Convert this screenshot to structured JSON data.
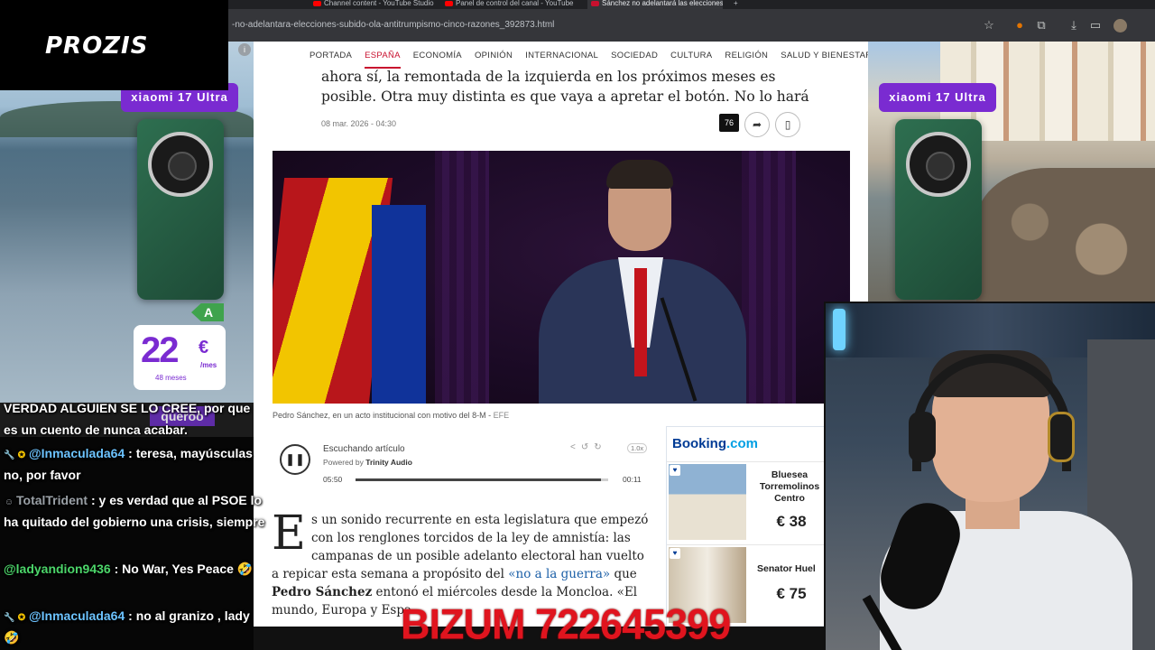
{
  "browser": {
    "tabs": [
      {
        "label": "Channel content - YouTube Studio",
        "active": false
      },
      {
        "label": "Panel de control del canal - YouTube",
        "active": false
      },
      {
        "label": "Sánchez no adelantará las elecciones",
        "active": true
      }
    ],
    "url": "-no-adelantara-elecciones-subido-ola-antitrumpismo-cinco-razones_392873.html",
    "icons": [
      "star-icon",
      "extension-icon",
      "puzzle-icon",
      "download-icon",
      "split-icon",
      "profile-avatar"
    ]
  },
  "site": {
    "nav": [
      "PORTADA",
      "ESPAÑA",
      "ECONOMÍA",
      "OPINIÓN",
      "INTERNACIONAL",
      "SOCIEDAD",
      "CULTURA",
      "RELIGIÓN",
      "SALUD Y BIENESTAR"
    ],
    "active_nav": "ESPAÑA"
  },
  "article": {
    "subhead_line1": "ahora sí, la remontada de la izquierda en los próximos meses es",
    "subhead_line2": "posible. Otra muy distinta es que vaya a apretar el botón. No lo hará",
    "date": "08 mar. 2026 - 04:30",
    "comment_count": "76",
    "caption": "Pedro Sánchez, en un acto institucional con motivo del 8-M",
    "caption_source": "EFE",
    "dropcap": "E",
    "body_1": "s un sonido recurrente en esta legislatura que empezó con los renglones torcidos de la ley de amnistía: las campanas de un posible adelanto electoral han vuelto a repicar esta semana a propósito del ",
    "body_link": "«no a la guerra»",
    "body_2": " que ",
    "body_bold": "Pedro Sánchez",
    "body_3": " entonó el miércoles desde la Moncloa. «El mundo, Europa y Espa"
  },
  "player": {
    "title": "Escuchando artículo",
    "powered_prefix": "Powered by",
    "powered_brand": "Trinity Audio",
    "elapsed": "05:50",
    "remaining": "00:11",
    "progress": 0.97,
    "speed": "1.0x"
  },
  "booking": {
    "logo": "Booking",
    "logo_suffix": ".com",
    "hotels": [
      {
        "name": "Bluesea Torremolinos Centro",
        "price": "€ 38"
      },
      {
        "name": "Senator Huel",
        "price": "€ 75"
      }
    ]
  },
  "ads": {
    "brand": "xiaomi 17 Ultra",
    "energy": "A",
    "price": "22",
    "currency": "€",
    "per": "/mes",
    "months": "48 meses"
  },
  "overlay": {
    "sponsor": "PROZIS",
    "sticker": "queroo",
    "bizum": "BIZUM 722645399"
  },
  "chat": [
    {
      "user": "",
      "text": "VERDAD ALGUIEN SE LO CREE, por que es un cuento de nunca acabar."
    },
    {
      "user": "@Inmaculada64",
      "text": " : teresa, mayúsculas no, por favor",
      "badges": true
    },
    {
      "user": "TotalTrident",
      "text": " : y es verdad que al PSOE lo ha quitado del gobierno una crisis, siempre",
      "badges": false,
      "gray": true
    },
    {
      "user": "@ladyandion9436",
      "text": " : No War, Yes Peace 🤣",
      "green": true
    },
    {
      "user": "@Inmaculada64",
      "text": " : no al granizo , lady 🤣",
      "badges": true
    }
  ]
}
